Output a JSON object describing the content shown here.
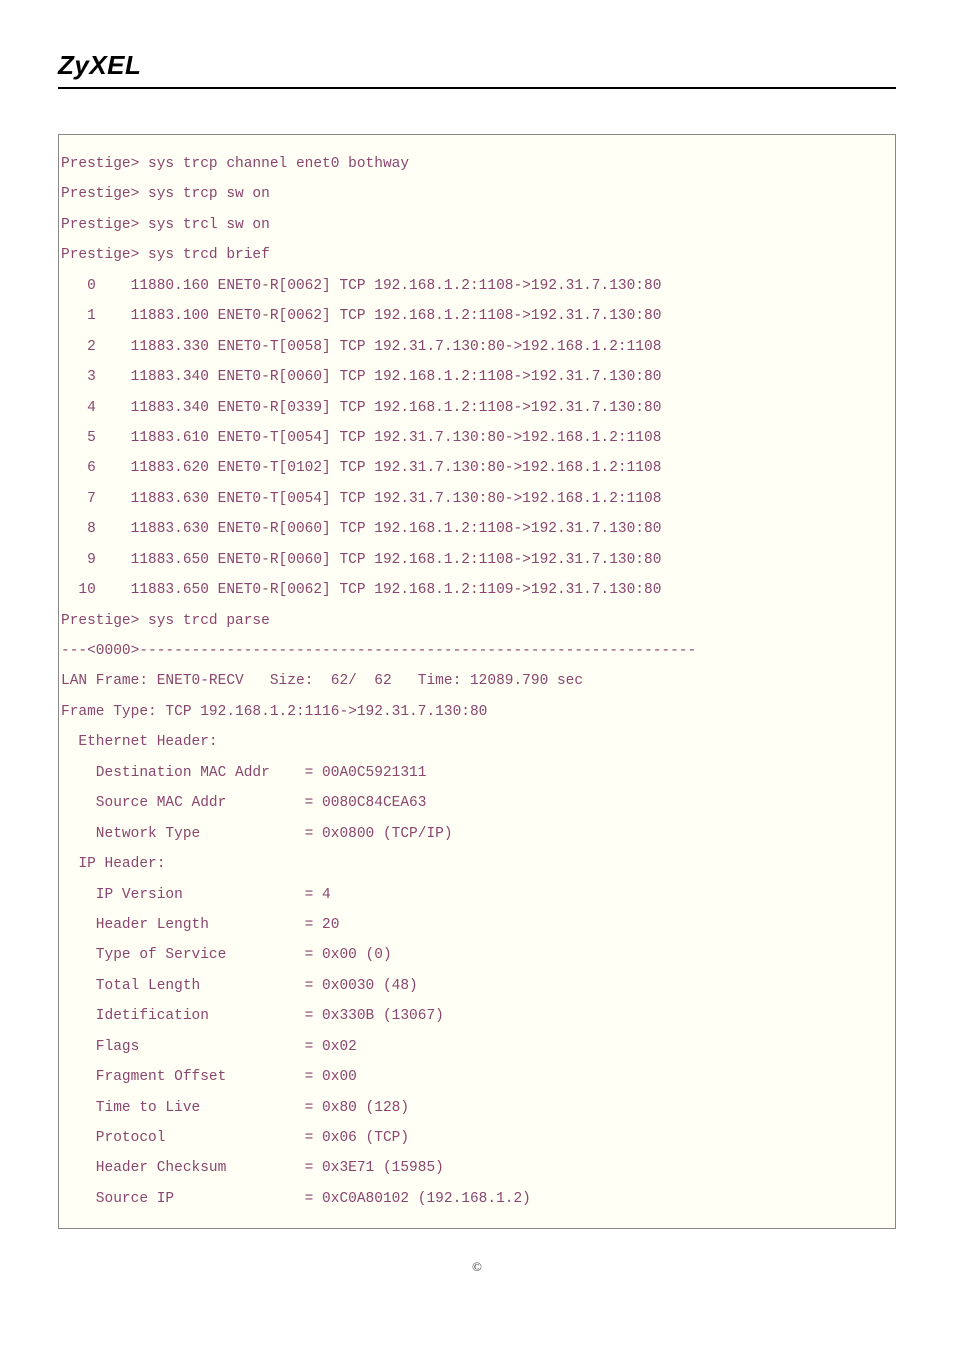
{
  "brand": "ZyXEL",
  "lines": [
    "Prestige> sys trcp channel enet0 bothway",
    "Prestige> sys trcp sw on",
    "Prestige> sys trcl sw on",
    "Prestige> sys trcd brief",
    "   0    11880.160 ENET0-R[0062] TCP 192.168.1.2:1108->192.31.7.130:80",
    "   1    11883.100 ENET0-R[0062] TCP 192.168.1.2:1108->192.31.7.130:80",
    "   2    11883.330 ENET0-T[0058] TCP 192.31.7.130:80->192.168.1.2:1108",
    "   3    11883.340 ENET0-R[0060] TCP 192.168.1.2:1108->192.31.7.130:80",
    "   4    11883.340 ENET0-R[0339] TCP 192.168.1.2:1108->192.31.7.130:80",
    "   5    11883.610 ENET0-T[0054] TCP 192.31.7.130:80->192.168.1.2:1108",
    "   6    11883.620 ENET0-T[0102] TCP 192.31.7.130:80->192.168.1.2:1108",
    "   7    11883.630 ENET0-T[0054] TCP 192.31.7.130:80->192.168.1.2:1108",
    "   8    11883.630 ENET0-R[0060] TCP 192.168.1.2:1108->192.31.7.130:80",
    "   9    11883.650 ENET0-R[0060] TCP 192.168.1.2:1108->192.31.7.130:80",
    "  10    11883.650 ENET0-R[0062] TCP 192.168.1.2:1109->192.31.7.130:80",
    "Prestige> sys trcd parse",
    "---<0000>----------------------------------------------------------------",
    "LAN Frame: ENET0-RECV   Size:  62/  62   Time: 12089.790 sec",
    "Frame Type: TCP 192.168.1.2:1116->192.31.7.130:80",
    "",
    "  Ethernet Header:",
    "    Destination MAC Addr    = 00A0C5921311",
    "    Source MAC Addr         = 0080C84CEA63",
    "    Network Type            = 0x0800 (TCP/IP)",
    "",
    "  IP Header:",
    "    IP Version              = 4",
    "    Header Length           = 20",
    "    Type of Service         = 0x00 (0)",
    "    Total Length            = 0x0030 (48)",
    "    Idetification           = 0x330B (13067)",
    "    Flags                   = 0x02",
    "    Fragment Offset         = 0x00",
    "    Time to Live            = 0x80 (128)",
    "    Protocol                = 0x06 (TCP)",
    "    Header Checksum         = 0x3E71 (15985)",
    "    Source IP               = 0xC0A80102 (192.168.1.2)"
  ],
  "footer": "©"
}
